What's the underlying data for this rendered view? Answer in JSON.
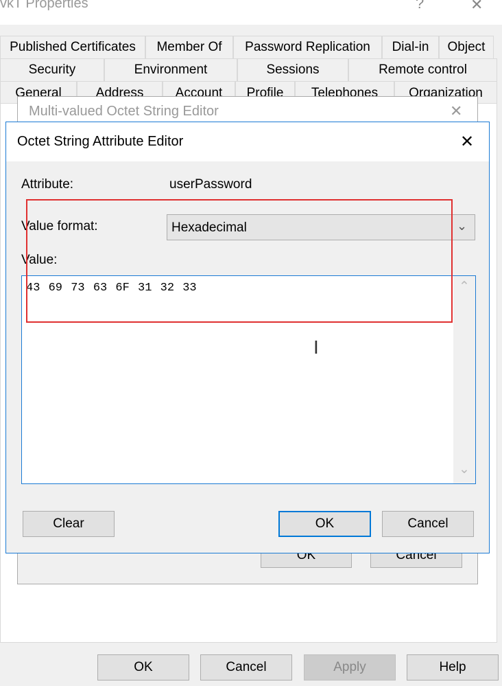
{
  "properties": {
    "title": "vkT Properties",
    "help_glyph": "?",
    "close_glyph": "✕",
    "tab_rows": [
      [
        "Published Certificates",
        "Member Of",
        "Password Replication",
        "Dial-in",
        "Object"
      ],
      [
        "Security",
        "Environment",
        "Sessions",
        "Remote control"
      ],
      [
        "General",
        "Address",
        "Account",
        "Profile",
        "Telephones",
        "Organization"
      ]
    ],
    "buttons": {
      "ok": "OK",
      "cancel": "Cancel",
      "apply": "Apply",
      "help": "Help"
    }
  },
  "multi_editor": {
    "title": "Multi-valued Octet String Editor",
    "close_glyph": "✕",
    "buttons": {
      "ok": "OK",
      "cancel": "Cancel"
    }
  },
  "octet_editor": {
    "title": "Octet String Attribute Editor",
    "close_glyph": "✕",
    "attribute_label": "Attribute:",
    "attribute_value": "userPassword",
    "value_format_label": "Value format:",
    "value_format": "Hexadecimal",
    "value_label": "Value:",
    "value": "43 69 73 63 6F 31 32 33",
    "buttons": {
      "clear": "Clear",
      "ok": "OK",
      "cancel": "Cancel"
    }
  },
  "colors": {
    "accent": "#0078d7",
    "highlight": "#e03030"
  }
}
